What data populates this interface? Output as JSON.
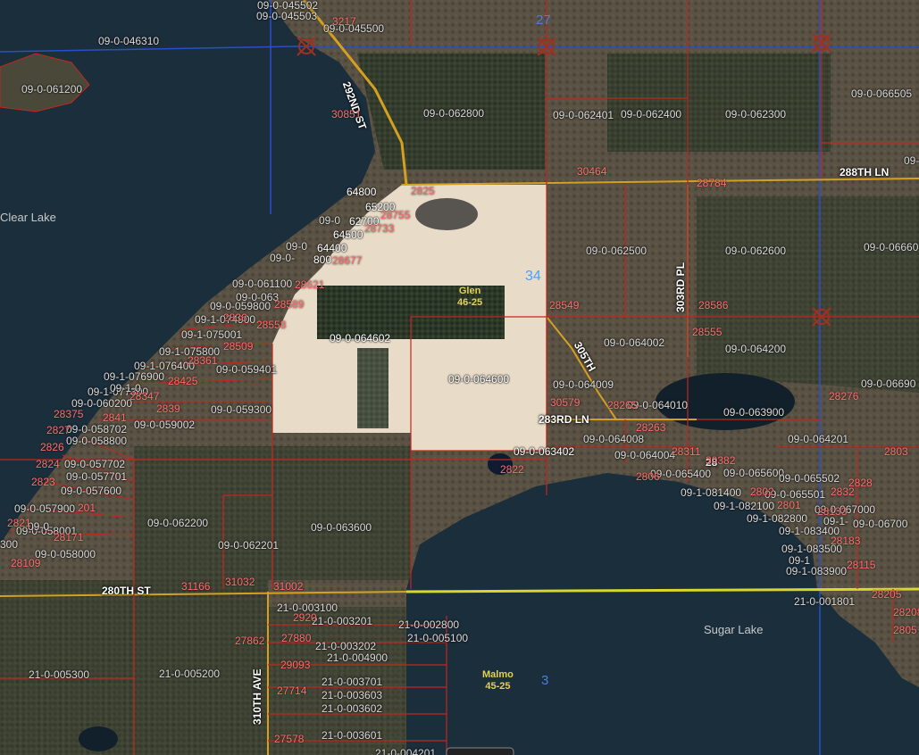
{
  "map": {
    "colors": {
      "parcel_line": "#c0281e",
      "section_line": "#2850c8",
      "road_line": "#d4a020",
      "township_line": "#d8d82a",
      "water": "#1b2e3c",
      "land": "#4a4838",
      "highlight": "#e8dcc8"
    },
    "lakes": [
      {
        "name": "Clear Lake"
      },
      {
        "name": "Sugar Lake"
      }
    ],
    "townships": [
      {
        "line1": "Glen",
        "line2": "46-25"
      },
      {
        "line1": "Malmo",
        "line2": "45-25"
      }
    ],
    "sections": [
      "34",
      "27",
      "3"
    ],
    "roads": [
      "292ND ST",
      "288TH LN",
      "303RD PL",
      "305TH",
      "283RD LN",
      "280TH ST",
      "310TH AVE",
      "28"
    ],
    "parcels_a": [
      "09-0-045502",
      "09-0-045503",
      "09-0-045500",
      "09-0-046310",
      "09-0-061200",
      "09-0-062800",
      "09-0-062401",
      "09-0-062400",
      "09-0-062300",
      "09-0-066505",
      "09-0-064800",
      "09-0-065200",
      "09-0-062700",
      "09-0-064500",
      "09-0-064400",
      "09-0-062500",
      "09-0-062600",
      "09-0-06660",
      "09-0-061100",
      "09-0-059800",
      "09-1-074900",
      "09-1-075001",
      "09-1-075800",
      "09-1-076400",
      "09-0-059401",
      "09-0-064602",
      "09-0-064002",
      "09-0-064200",
      "09-1-076900",
      "09-1-077300",
      "09-0-060200",
      "09-0-059300",
      "09-0-064600",
      "09-0-064009",
      "09-0-064010",
      "09-0-063900",
      "09-0-06690",
      "09-0-059002",
      "09-0-058702",
      "09-0-058800",
      "09-0-064008"
    ],
    "parcels_b": [
      "09-0-064201",
      "09-0-063402",
      "09-0-064004",
      "09-0-065400",
      "09-0-065600",
      "09-0-065502",
      "09-0-057702",
      "09-0-057701",
      "09-0-057600",
      "09-1-081400",
      "09-0-065501",
      "09-0-057900",
      "09-1-082100",
      "09-0-067000",
      "09-0-058001",
      "09-1-082800",
      "09-0-06700",
      "09-0-062200",
      "09-0-063600",
      "09-1-083400",
      "09-0-062201",
      "09-1-083500",
      "09-0-058000",
      "09-1-083900",
      "21-0-003100",
      "21-0-001801",
      "21-0-003201",
      "21-0-002800",
      "21-0-005100",
      "21-0-003202",
      "21-0-004900",
      "21-0-005300",
      "21-0-005200",
      "21-0-003701",
      "21-0-003603",
      "21-0-003602",
      "21-0-003601",
      "21-0-004201",
      "09-0-",
      "09-0",
      "09-0",
      "09-0-063",
      "09-1-0",
      "09-0",
      "09-1-",
      "09-1",
      "300",
      "09-",
      "64800",
      "65200",
      "62700",
      "64500",
      "64400",
      "800"
    ],
    "addresses": [
      "30851",
      "30464",
      "28784",
      "28755",
      "28733",
      "28677",
      "28621",
      "28589",
      "28558",
      "28549",
      "28586",
      "28555",
      "28509",
      "28425",
      "28276",
      "28375",
      "28263",
      "30579",
      "30382",
      "28183",
      "28115",
      "28133",
      "28109",
      "28171",
      "31166",
      "31032",
      "31002",
      "27862",
      "27880",
      "27714",
      "27578",
      "2920",
      "29093",
      "28205",
      "28208",
      "28265",
      "28311",
      "28347",
      "28361",
      "2827",
      "2826",
      "2824",
      "2823",
      "2821",
      "2806",
      "2802",
      "2801",
      "2805",
      "2803",
      "2822",
      "2825",
      "2828",
      "2832",
      "2836",
      "2839",
      "2841",
      "201",
      "3217"
    ]
  }
}
